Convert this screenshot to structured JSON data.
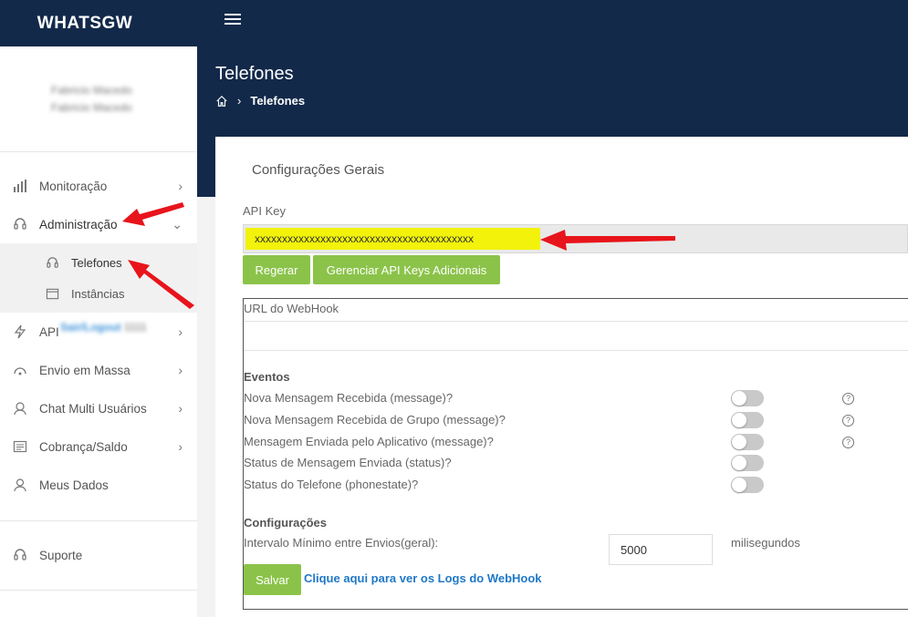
{
  "app": {
    "brand": "WHATSGW"
  },
  "profile": {
    "name": "Fabricio Macedo",
    "subtitle": "Fabricio Macedo",
    "link": "Sair/Logout",
    "extra": "1111"
  },
  "sidebar": {
    "items": [
      {
        "label": "Monitoração",
        "icon": "bar-chart-icon"
      },
      {
        "label": "Administração",
        "icon": "headset-icon"
      },
      {
        "label": "API",
        "icon": "bolt-icon"
      },
      {
        "label": "Envio em Massa",
        "icon": "broadcast-icon"
      },
      {
        "label": "Chat Multi Usuários",
        "icon": "chat-user-icon"
      },
      {
        "label": "Cobrança/Saldo",
        "icon": "invoice-icon"
      },
      {
        "label": "Meus Dados",
        "icon": "user-icon"
      }
    ],
    "subitems": [
      {
        "label": "Telefones",
        "icon": "headset-icon"
      },
      {
        "label": "Instâncias",
        "icon": "window-icon"
      }
    ],
    "support": {
      "label": "Suporte",
      "icon": "headset-icon"
    }
  },
  "header": {
    "title": "Telefones",
    "breadcrumb_current": "Telefones"
  },
  "card": {
    "title": "Configurações Gerais",
    "api_key_label": "API Key",
    "api_key_value": "xxxxxxxxxxxxxxxxxxxxxxxxxxxxxxxxxxxxxxxx",
    "btn_regerar": "Regerar",
    "btn_gerenciar": "Gerenciar API Keys Adicionais",
    "webhook_label": "URL do WebHook",
    "webhook_value": "",
    "events_title": "Eventos",
    "events": [
      {
        "label": "Nova Mensagem Recebida (message)?",
        "enabled": false,
        "help": true
      },
      {
        "label": "Nova Mensagem Recebida de Grupo (message)?",
        "enabled": false,
        "help": true
      },
      {
        "label": "Mensagem Enviada pelo Aplicativo (message)?",
        "enabled": false,
        "help": true
      },
      {
        "label": "Status de Mensagem Enviada (status)?",
        "enabled": false,
        "help": false
      },
      {
        "label": "Status do Telefone (phonestate)?",
        "enabled": false,
        "help": false
      }
    ],
    "help_glyph": "?",
    "config_title": "Configurações",
    "interval_label": "Intervalo Mínimo entre Envios(geral):",
    "interval_value": "5000",
    "interval_unit": "milisegundos",
    "btn_salvar": "Salvar",
    "logs_link": "Clique aqui para ver os Logs do WebHook"
  },
  "colors": {
    "navy": "#12294a",
    "green": "#8bc34a",
    "highlight": "#f2f20a",
    "arrow": "#e8141b",
    "link": "#1f78c8"
  }
}
